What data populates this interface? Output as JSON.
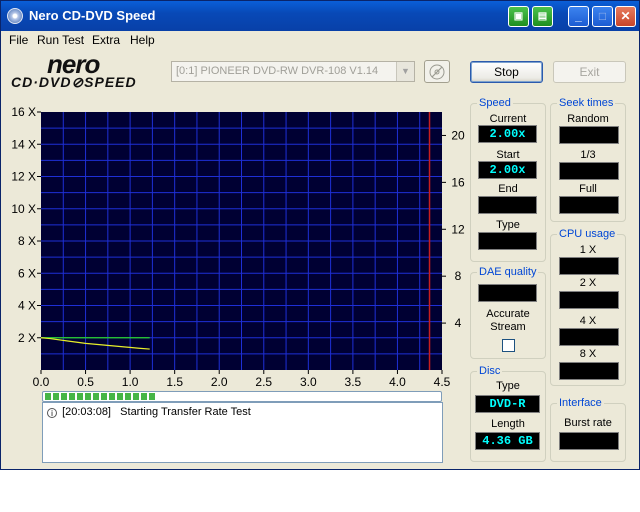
{
  "window": {
    "title": "Nero CD-DVD Speed"
  },
  "menu": {
    "file": "File",
    "run_test": "Run Test",
    "extra": "Extra",
    "help": "Help"
  },
  "logo": {
    "line1": "nero",
    "line2": "CD·DVD⊘SPEED"
  },
  "drive": {
    "selected": "[0:1]  PIONEER DVD-RW  DVR-108 V1.14"
  },
  "buttons": {
    "stop": "Stop",
    "exit": "Exit"
  },
  "speed": {
    "title": "Speed",
    "current_label": "Current",
    "current": "2.00x",
    "start_label": "Start",
    "start": "2.00x",
    "end_label": "End",
    "end": "",
    "type_label": "Type",
    "type": ""
  },
  "seek": {
    "title": "Seek times",
    "random_label": "Random",
    "random": "",
    "third_label": "1/3",
    "third": "",
    "full_label": "Full",
    "full": ""
  },
  "cpu": {
    "title": "CPU usage",
    "x1_label": "1 X",
    "x1": "",
    "x2_label": "2 X",
    "x2": "",
    "x4_label": "4 X",
    "x4": "",
    "x8_label": "8 X",
    "x8": ""
  },
  "dae": {
    "title": "DAE quality",
    "value": "",
    "accurate_stream_label": "Accurate Stream",
    "accurate_stream_checked": false
  },
  "disc": {
    "title": "Disc",
    "type_label": "Type",
    "type": "DVD-R",
    "length_label": "Length",
    "length": "4.36 GB"
  },
  "interface": {
    "title": "Interface",
    "burst_label": "Burst rate",
    "burst": ""
  },
  "log": {
    "timestamp": "[20:03:08]",
    "message": "Starting Transfer Rate Test"
  },
  "progress": {
    "fraction": 0.28
  },
  "chart_data": {
    "type": "line",
    "x_ticks": [
      "0.0",
      "0.5",
      "1.0",
      "1.5",
      "2.0",
      "2.5",
      "3.0",
      "3.5",
      "4.0",
      "4.5"
    ],
    "y_left_ticks": [
      "2 X",
      "4 X",
      "6 X",
      "8 X",
      "10 X",
      "12 X",
      "14 X",
      "16 X"
    ],
    "y_right_ticks": [
      "4",
      "8",
      "12",
      "16",
      "20"
    ],
    "xlim": [
      0,
      4.5
    ],
    "ylim_left": [
      0,
      16
    ],
    "ylim_right": [
      0,
      22
    ],
    "grid": true,
    "end_marker_x": 4.36,
    "colors": {
      "background": "#000033",
      "grid": "#1e2fd6",
      "transfer_rate": "#e8ef2a",
      "speed": "#2ad62a",
      "end_marker": "#c81e1e"
    },
    "series": [
      {
        "color": "#2ad62a",
        "axis": "left",
        "x": [
          0.0,
          1.22
        ],
        "y": [
          2.0,
          2.0
        ]
      },
      {
        "color": "#e8ef2a",
        "axis": "left",
        "x": [
          0.0,
          0.1,
          0.3,
          0.5,
          0.7,
          0.9,
          1.1,
          1.22
        ],
        "y": [
          2.0,
          1.95,
          1.8,
          1.65,
          1.55,
          1.45,
          1.35,
          1.3
        ]
      }
    ]
  }
}
